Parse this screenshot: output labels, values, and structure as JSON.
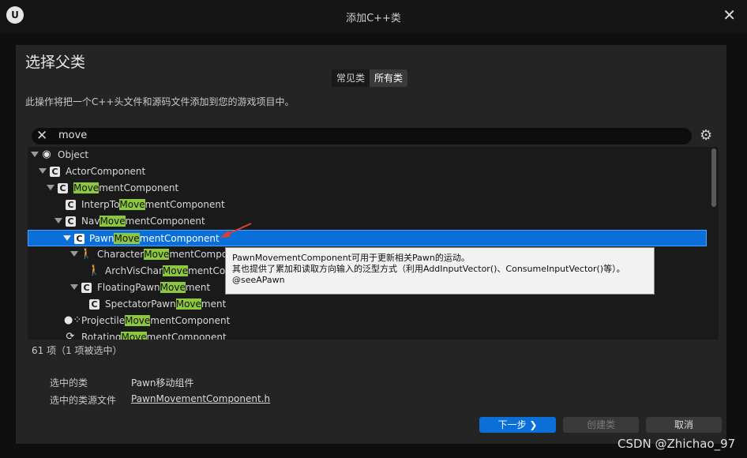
{
  "window": {
    "title": "添加C++类",
    "logo": "ue-logo",
    "close": "✕"
  },
  "heading": "选择父类",
  "tabs": [
    {
      "label": "常见类",
      "active": false
    },
    {
      "label": "所有类",
      "active": true
    }
  ],
  "description": "此操作将把一个C++头文件和源码文件添加到您的游戏项目中。",
  "search": {
    "value": "move",
    "clear_icon": "close-icon",
    "settings_icon": "gear-icon"
  },
  "tree": [
    {
      "pre": "Object",
      "hl": "",
      "post": "",
      "icon": "object-icon",
      "expandable": true
    },
    {
      "pre": "ActorComponent",
      "hl": "",
      "post": "",
      "icon": "class-icon",
      "expandable": true
    },
    {
      "pre": "",
      "hl": "Move",
      "post": "mentComponent",
      "icon": "class-icon",
      "expandable": true
    },
    {
      "pre": "InterpTo",
      "hl": "Move",
      "post": "mentComponent",
      "icon": "class-icon",
      "expandable": false
    },
    {
      "pre": "Nav",
      "hl": "Move",
      "post": "mentComponent",
      "icon": "class-icon",
      "expandable": true
    },
    {
      "pre": "Pawn",
      "hl": "Move",
      "post": "mentComponent",
      "icon": "class-icon",
      "expandable": true,
      "selected": true
    },
    {
      "pre": "Character",
      "hl": "Move",
      "post": "mentCompo",
      "icon": "character-movement-icon",
      "expandable": true
    },
    {
      "pre": "ArchVisChar",
      "hl": "Move",
      "post": "mentCo",
      "icon": "character-movement-icon",
      "expandable": false
    },
    {
      "pre": "FloatingPawn",
      "hl": "Move",
      "post": "ment",
      "icon": "class-icon",
      "expandable": true
    },
    {
      "pre": "SpectatorPawn",
      "hl": "Move",
      "post": "ment",
      "icon": "class-icon",
      "expandable": false
    },
    {
      "pre": "Projectile",
      "hl": "Move",
      "post": "mentComponent",
      "icon": "projectile-icon",
      "expandable": false
    },
    {
      "pre": "Rotating",
      "hl": "Move",
      "post": "mentComponent",
      "icon": "rotating-icon",
      "expandable": false
    }
  ],
  "tooltip": {
    "line1": "PawnMovementComponent可用于更新相关Pawn的运动。",
    "line2": "其也提供了累加和读取方向输入的泛型方式（利用AddInputVector()、ConsumeInputVector()等）。",
    "line3": "@seeAPawn"
  },
  "count": "61 项（1 项被选中）",
  "selected_class": {
    "label": "选中的类",
    "value": "Pawn移动组件"
  },
  "selected_source": {
    "label": "选中的类源文件",
    "value": "PawnMovementComponent.h"
  },
  "buttons": {
    "next": "下一步 ❯",
    "create": "创建类",
    "cancel": "取消"
  },
  "watermark": "CSDN @Zhichao_97",
  "colors": {
    "selection": "#0a6fd8",
    "highlight": "#8dc63f",
    "annotation_arrow": "#e0402a"
  }
}
